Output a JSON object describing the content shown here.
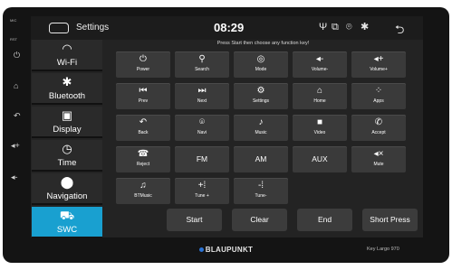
{
  "hardware": {
    "mic_label": "MIC",
    "rst_label": "RST",
    "buttons": [
      {
        "name": "power-button",
        "glyph": "⏻"
      },
      {
        "name": "home-button",
        "glyph": "⌂"
      },
      {
        "name": "back-button",
        "glyph": "↶"
      },
      {
        "name": "volume-up-button",
        "glyph": "◂+"
      },
      {
        "name": "volume-down-button",
        "glyph": "◂-"
      }
    ]
  },
  "status_bar": {
    "title": "Settings",
    "time": "08:29",
    "icons": {
      "usb": "Ψ",
      "cast": "⧉",
      "location": "⌾",
      "bluetooth": "✱"
    },
    "back_glyph": "⮌"
  },
  "sidebar": {
    "items": [
      {
        "label": "Wi-Fi",
        "icon": "wifi-icon",
        "glyph": "◠"
      },
      {
        "label": "Bluetooth",
        "icon": "bluetooth-icon",
        "glyph": "✱"
      },
      {
        "label": "Display",
        "icon": "display-icon",
        "glyph": "▣"
      },
      {
        "label": "Time",
        "icon": "clock-icon",
        "glyph": "◷"
      },
      {
        "label": "Navigation",
        "icon": "location-pin-icon",
        "glyph": "⬤"
      },
      {
        "label": "SWC",
        "icon": "steering-car-icon",
        "glyph": "⛟",
        "active": true
      }
    ]
  },
  "hint": "Press Start then choose any function key!",
  "keys": [
    {
      "label": "Power",
      "glyph": "⏻"
    },
    {
      "label": "Search",
      "glyph": "⚲"
    },
    {
      "label": "Mode",
      "glyph": "◎"
    },
    {
      "label": "Volume-",
      "glyph": "◂-"
    },
    {
      "label": "Volume+",
      "glyph": "◂+"
    },
    {
      "label": "Prev",
      "glyph": "⏮"
    },
    {
      "label": "Next",
      "glyph": "⏭"
    },
    {
      "label": "Settings",
      "glyph": "⚙"
    },
    {
      "label": "Home",
      "glyph": "⌂"
    },
    {
      "label": "Apps",
      "glyph": "⁘"
    },
    {
      "label": "Back",
      "glyph": "↶"
    },
    {
      "label": "Navi",
      "glyph": "⌾"
    },
    {
      "label": "Music",
      "glyph": "♪"
    },
    {
      "label": "Video",
      "glyph": "■"
    },
    {
      "label": "Accept",
      "glyph": "✆"
    },
    {
      "label": "Reject",
      "glyph": "☎"
    },
    {
      "label": "FM",
      "glyph": ""
    },
    {
      "label": "AM",
      "glyph": ""
    },
    {
      "label": "AUX",
      "glyph": ""
    },
    {
      "label": "Mute",
      "glyph": "◂×"
    },
    {
      "label": "BTMusic",
      "glyph": "♫"
    },
    {
      "label": "Tune +",
      "glyph": "+⁞"
    },
    {
      "label": "Tune-",
      "glyph": "-⁞"
    }
  ],
  "actions": {
    "start": "Start",
    "clear": "Clear",
    "end": "End",
    "short_press": "Short Press"
  },
  "brand": "BLAUPUNKT",
  "model": "Key Largo 970",
  "colors": {
    "active_tab": "#19a0d0",
    "key_bg": "#3a3a3a",
    "screen_bg": "#232323"
  }
}
